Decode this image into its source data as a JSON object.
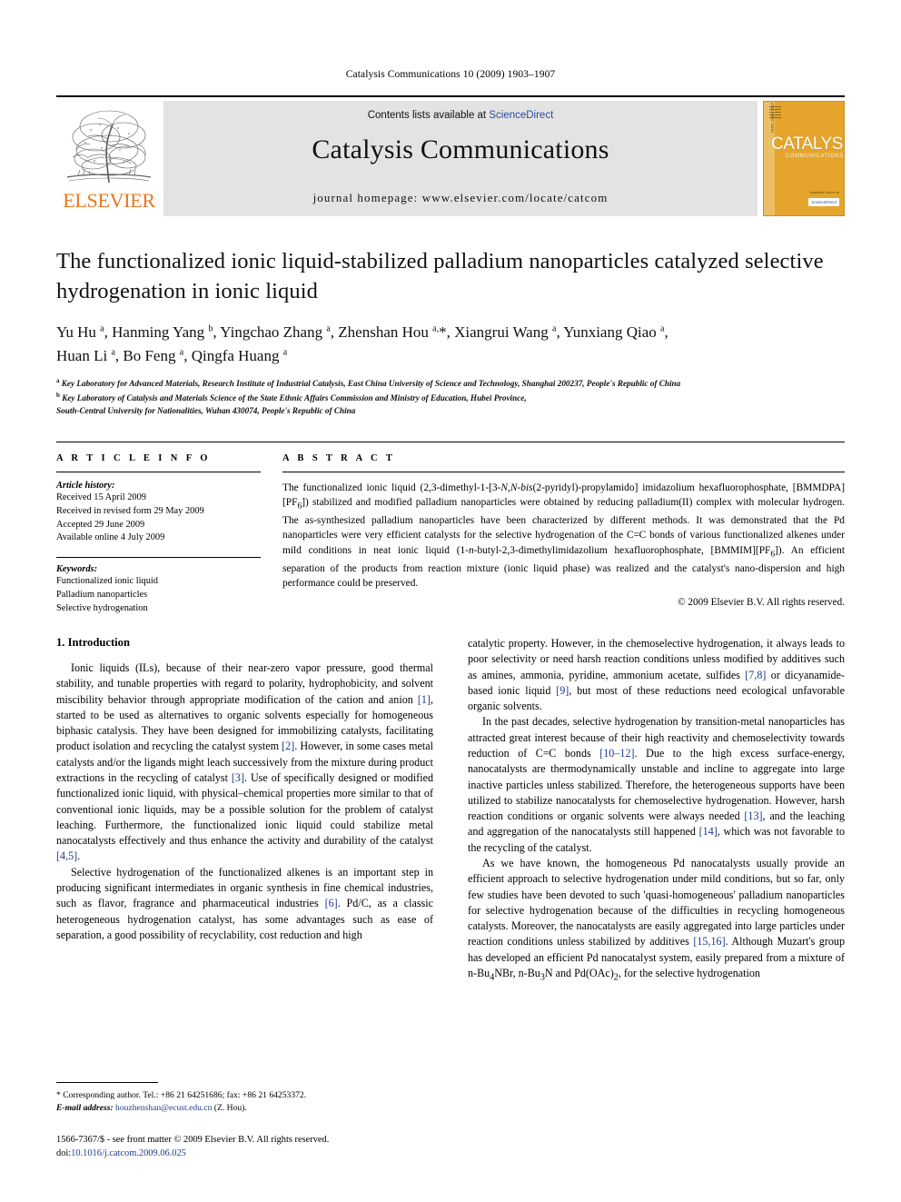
{
  "running_head": "Catalysis Communications 10 (2009) 1903–1907",
  "masthead": {
    "publisher_name": "ELSEVIER",
    "contents_prefix": "Contents lists available at ",
    "contents_link": "ScienceDirect",
    "journal_name": "Catalysis Communications",
    "homepage": "journal homepage: www.elsevier.com/locate/catcom",
    "cover": {
      "title": "CATALYSIS",
      "subtitle": "COMMUNICATIONS",
      "side_text": "ISSN 1566-7367",
      "foot_left": "Available online at\nwww.sciencedirect.com",
      "foot_right": "Available online at",
      "badge": "ScienceDirect"
    }
  },
  "article": {
    "title": "The functionalized ionic liquid-stabilized palladium nanoparticles catalyzed selective hydrogenation in ionic liquid",
    "authors_line1": "Yu Hu a, Hanming Yang b, Yingchao Zhang a, Zhenshan Hou a,*, Xiangrui Wang a, Yunxiang Qiao a,",
    "authors_line2": "Huan Li a, Bo Feng a, Qingfa Huang a",
    "affiliation_a": "Key Laboratory for Advanced Materials, Research Institute of Industrial Catalysis, East China University of Science and Technology, Shanghai 200237, People's Republic of China",
    "affiliation_b_line1": "Key Laboratory of Catalysis and Materials Science of the State Ethnic Affairs Commission and Ministry of Education, Hubei Province,",
    "affiliation_b_line2": "South-Central University for Nationalities, Wuhan 430074, People's Republic of China"
  },
  "article_info": {
    "heading": "A R T I C L E    I N F O",
    "history_label": "Article history:",
    "history": [
      "Received 15 April 2009",
      "Received in revised form 29 May 2009",
      "Accepted 29 June 2009",
      "Available online 4 July 2009"
    ],
    "keywords_label": "Keywords:",
    "keywords": [
      "Functionalized ionic liquid",
      "Palladium nanoparticles",
      "Selective hydrogenation"
    ]
  },
  "abstract": {
    "heading": "A B S T R A C T",
    "text": "The functionalized ionic liquid (2,3-dimethyl-1-[3-N,N-bis(2-pyridyl)-propylamido] imidazolium hexafluorophosphate, [BMMDPA][PF6]) stabilized and modified palladium nanoparticles were obtained by reducing palladium(II) complex with molecular hydrogen. The as-synthesized palladium nanoparticles have been characterized by different methods. It was demonstrated that the Pd nanoparticles were very efficient catalysts for the selective hydrogenation of the C=C bonds of various functionalized alkenes under mild conditions in neat ionic liquid (1-n-butyl-2,3-dimethylimidazolium hexafluorophosphate, [BMMIM][PF6]). An efficient separation of the products from reaction mixture (ionic liquid phase) was realized and the catalyst's nano-dispersion and high performance could be preserved.",
    "copyright": "© 2009 Elsevier B.V. All rights reserved."
  },
  "body": {
    "section_title": "1. Introduction",
    "left_paragraphs": [
      "Ionic liquids (ILs), because of their near-zero vapor pressure, good thermal stability, and tunable properties with regard to polarity, hydrophobicity, and solvent miscibility behavior through appropriate modification of the cation and anion [1], started to be used as alternatives to organic solvents especially for homogeneous biphasic catalysis. They have been designed for immobilizing catalysts, facilitating product isolation and recycling the catalyst system [2]. However, in some cases metal catalysts and/or the ligands might leach successively from the mixture during product extractions in the recycling of catalyst [3]. Use of specifically designed or modified functionalized ionic liquid, with physical–chemical properties more similar to that of conventional ionic liquids, may be a possible solution for the problem of catalyst leaching. Furthermore, the functionalized ionic liquid could stabilize metal nanocatalysts effectively and thus enhance the activity and durability of the catalyst [4,5].",
      "Selective hydrogenation of the functionalized alkenes is an important step in producing significant intermediates in organic synthesis in fine chemical industries, such as flavor, fragrance and pharmaceutical industries [6]. Pd/C, as a classic heterogeneous hydrogenation catalyst, has some advantages such as ease of separation, a good possibility of recyclability, cost reduction and high"
    ],
    "right_paragraphs": [
      "catalytic property. However, in the chemoselective hydrogenation, it always leads to poor selectivity or need harsh reaction conditions unless modified by additives such as amines, ammonia, pyridine, ammonium acetate, sulfides [7,8] or dicyanamide-based ionic liquid [9], but most of these reductions need ecological unfavorable organic solvents.",
      "In the past decades, selective hydrogenation by transition-metal nanoparticles has attracted great interest because of their high reactivity and chemoselectivity towards reduction of C=C bonds [10–12]. Due to the high excess surface-energy, nanocatalysts are thermodynamically unstable and incline to aggregate into large inactive particles unless stabilized. Therefore, the heterogeneous supports have been utilized to stabilize nanocatalysts for chemoselective hydrogenation. However, harsh reaction conditions or organic solvents were always needed [13], and the leaching and aggregation of the nanocatalysts still happened [14], which was not favorable to the recycling of the catalyst.",
      "As we have known, the homogeneous Pd nanocatalysts usually provide an efficient approach to selective hydrogenation under mild conditions, but so far, only few studies have been devoted to such 'quasi-homogeneous' palladium nanoparticles for selective hydrogenation because of the difficulties in recycling homogeneous catalysts. Moreover, the nanocatalysts are easily aggregated into large particles under reaction conditions unless stabilized by additives [15,16]. Although Muzart's group has developed an efficient Pd nanocatalyst system, easily prepared from a mixture of n-Bu4NBr, n-Bu3N and Pd(OAc)2, for the selective hydrogenation"
    ]
  },
  "footnote": {
    "corresponding": "* Corresponding author. Tel.: +86 21 64251686; fax: +86 21 64253372.",
    "email_label": "E-mail address:",
    "email": "houzhenshan@ecust.edu.cn",
    "email_suffix": "(Z. Hou)."
  },
  "footer": {
    "issn_line": "1566-7367/$ - see front matter © 2009 Elsevier B.V. All rights reserved.",
    "doi_prefix": "doi:",
    "doi": "10.1016/j.catcom.2009.06.025"
  },
  "colors": {
    "elsevier_orange": "#E87722",
    "link_blue": "#2b4c9b",
    "ref_blue": "#1d3c8c",
    "band_gray": "#e3e3e3",
    "cover_orange": "#E5A52C"
  }
}
